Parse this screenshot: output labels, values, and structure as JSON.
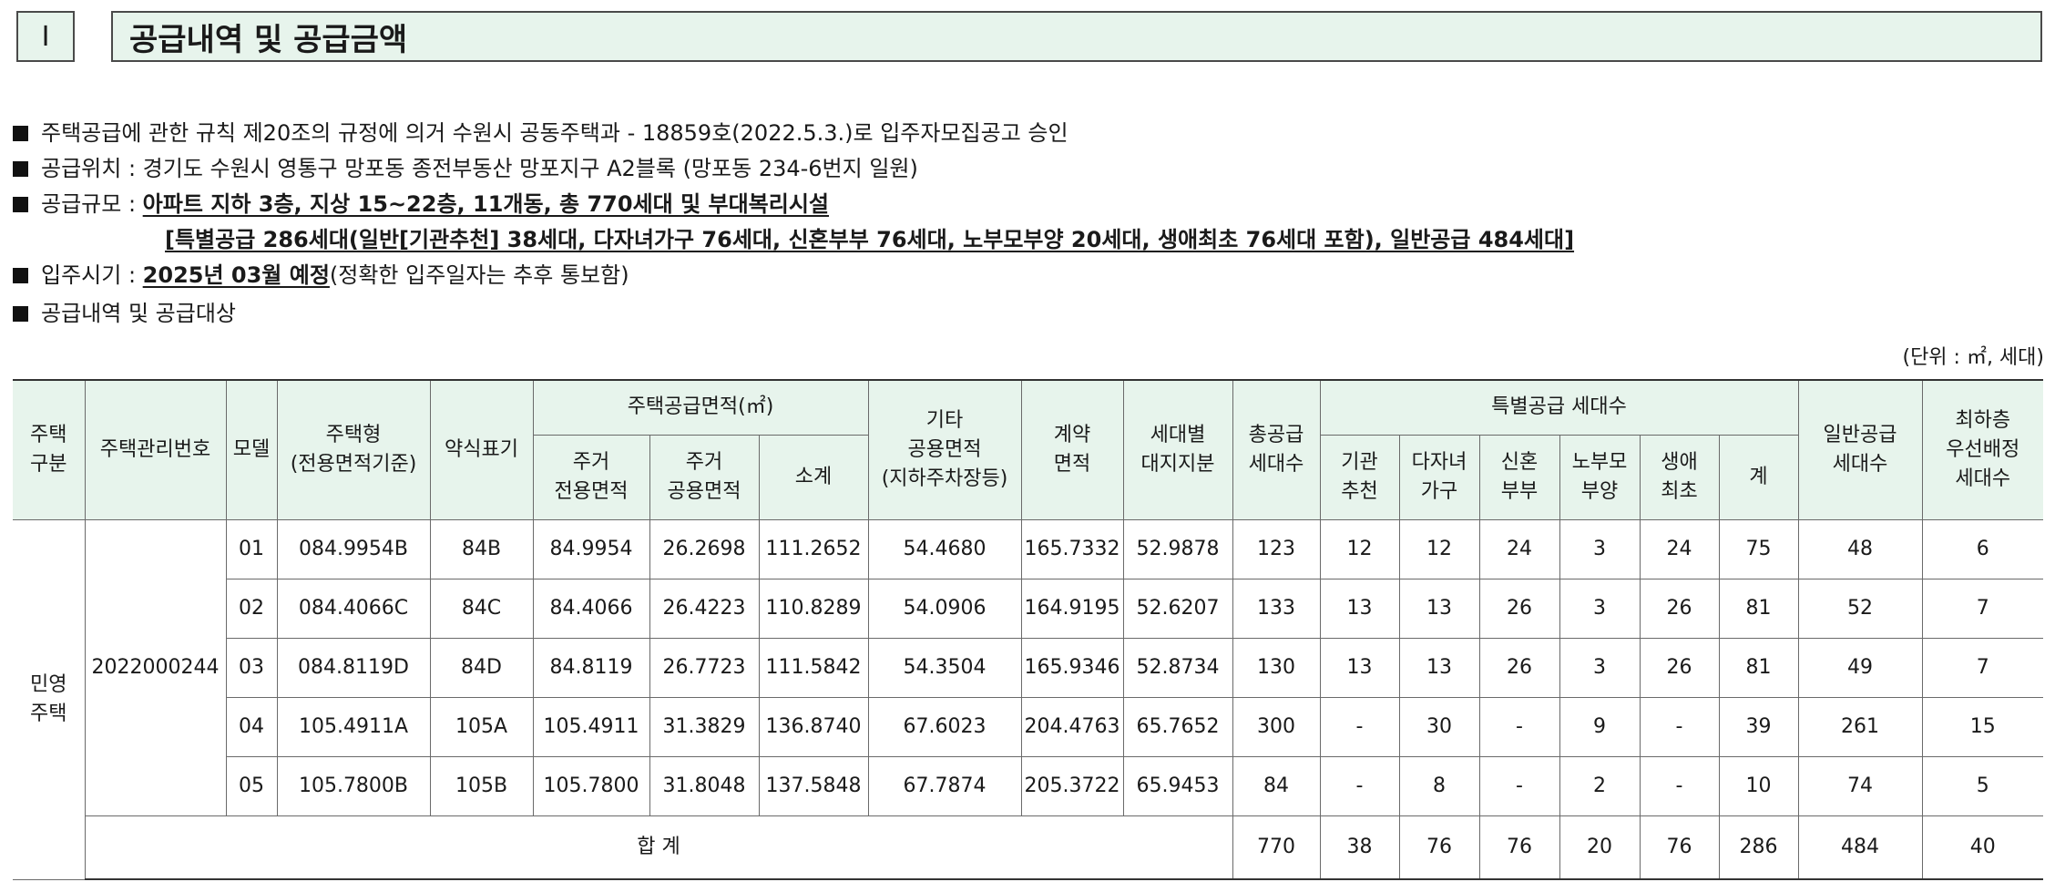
{
  "section": {
    "number": "Ⅰ",
    "title": "공급내역 및 공급금액"
  },
  "bullets": {
    "approval": "주택공급에 관한 규칙 제20조의 규정에 의거 수원시 공동주택과 - 18859호(2022.5.3.)로 입주자모집공고 승인",
    "location": "공급위치 : 경기도 수원시 영통구 망포동 종전부동산 망포지구 A2블록 (망포동 234-6번지 일원)",
    "scale_label": "공급규모 : ",
    "scale_value": "아파트 지하 3층, 지상 15~22층, 11개동, 총 770세대 및 부대복리시설",
    "scale_detail": "[특별공급 286세대(일반[기관추천] 38세대, 다자녀가구 76세대, 신혼부부 76세대, 노부모부양 20세대, 생애최초 76세대 포함), 일반공급 484세대]",
    "movein_label": "입주시기 : ",
    "movein_value": "2025년 03월 예정",
    "movein_note": "(정확한 입주일자는 추후 통보함)",
    "supply_list": "공급내역 및 공급대상"
  },
  "unit_note": "(단위 : ㎡, 세대)",
  "table": {
    "headers": {
      "type": "주택\n구분",
      "mgmt_no": "주택관리번호",
      "model": "모델",
      "housing_type": "주택형\n(전용면적기준)",
      "abbr": "약식표기",
      "supply_area": "주택공급면적(㎡)",
      "exclusive": "주거\n전용면적",
      "common": "주거\n공용면적",
      "subtotal": "소계",
      "other_common": "기타\n공용면적\n(지하주차장등)",
      "contract_area": "계약\n면적",
      "land_share": "세대별\n대지지분",
      "total_units": "총공급\n세대수",
      "special": "특별공급 세대수",
      "sp_agency": "기관\n추천",
      "sp_multi": "다자녀\n가구",
      "sp_newlywed": "신혼\n부부",
      "sp_parents": "노부모\n부양",
      "sp_first": "생애\n최초",
      "sp_sum": "계",
      "general": "일반공급\n세대수",
      "lowest_floor": "최하층\n우선배정\n세대수"
    },
    "housing_category": "민영\n주택",
    "management_number": "2022000244",
    "rows": [
      {
        "model": "01",
        "type": "084.9954B",
        "abbr": "84B",
        "exclusive": "84.9954",
        "common": "26.2698",
        "subtotal": "111.2652",
        "other": "54.4680",
        "contract": "165.7332",
        "land": "52.9878",
        "total": "123",
        "agency": "12",
        "multi": "12",
        "newlywed": "24",
        "parents": "3",
        "first": "24",
        "sp_sum": "75",
        "general": "48",
        "lowest": "6"
      },
      {
        "model": "02",
        "type": "084.4066C",
        "abbr": "84C",
        "exclusive": "84.4066",
        "common": "26.4223",
        "subtotal": "110.8289",
        "other": "54.0906",
        "contract": "164.9195",
        "land": "52.6207",
        "total": "133",
        "agency": "13",
        "multi": "13",
        "newlywed": "26",
        "parents": "3",
        "first": "26",
        "sp_sum": "81",
        "general": "52",
        "lowest": "7"
      },
      {
        "model": "03",
        "type": "084.8119D",
        "abbr": "84D",
        "exclusive": "84.8119",
        "common": "26.7723",
        "subtotal": "111.5842",
        "other": "54.3504",
        "contract": "165.9346",
        "land": "52.8734",
        "total": "130",
        "agency": "13",
        "multi": "13",
        "newlywed": "26",
        "parents": "3",
        "first": "26",
        "sp_sum": "81",
        "general": "49",
        "lowest": "7"
      },
      {
        "model": "04",
        "type": "105.4911A",
        "abbr": "105A",
        "exclusive": "105.4911",
        "common": "31.3829",
        "subtotal": "136.8740",
        "other": "67.6023",
        "contract": "204.4763",
        "land": "65.7652",
        "total": "300",
        "agency": "-",
        "multi": "30",
        "newlywed": "-",
        "parents": "9",
        "first": "-",
        "sp_sum": "39",
        "general": "261",
        "lowest": "15"
      },
      {
        "model": "05",
        "type": "105.7800B",
        "abbr": "105B",
        "exclusive": "105.7800",
        "common": "31.8048",
        "subtotal": "137.5848",
        "other": "67.7874",
        "contract": "205.3722",
        "land": "65.9453",
        "total": "84",
        "agency": "-",
        "multi": "8",
        "newlywed": "-",
        "parents": "2",
        "first": "-",
        "sp_sum": "10",
        "general": "74",
        "lowest": "5"
      }
    ],
    "total": {
      "label": "합 계",
      "total": "770",
      "agency": "38",
      "multi": "76",
      "newlywed": "76",
      "parents": "20",
      "first": "76",
      "sp_sum": "286",
      "general": "484",
      "lowest": "40"
    }
  }
}
